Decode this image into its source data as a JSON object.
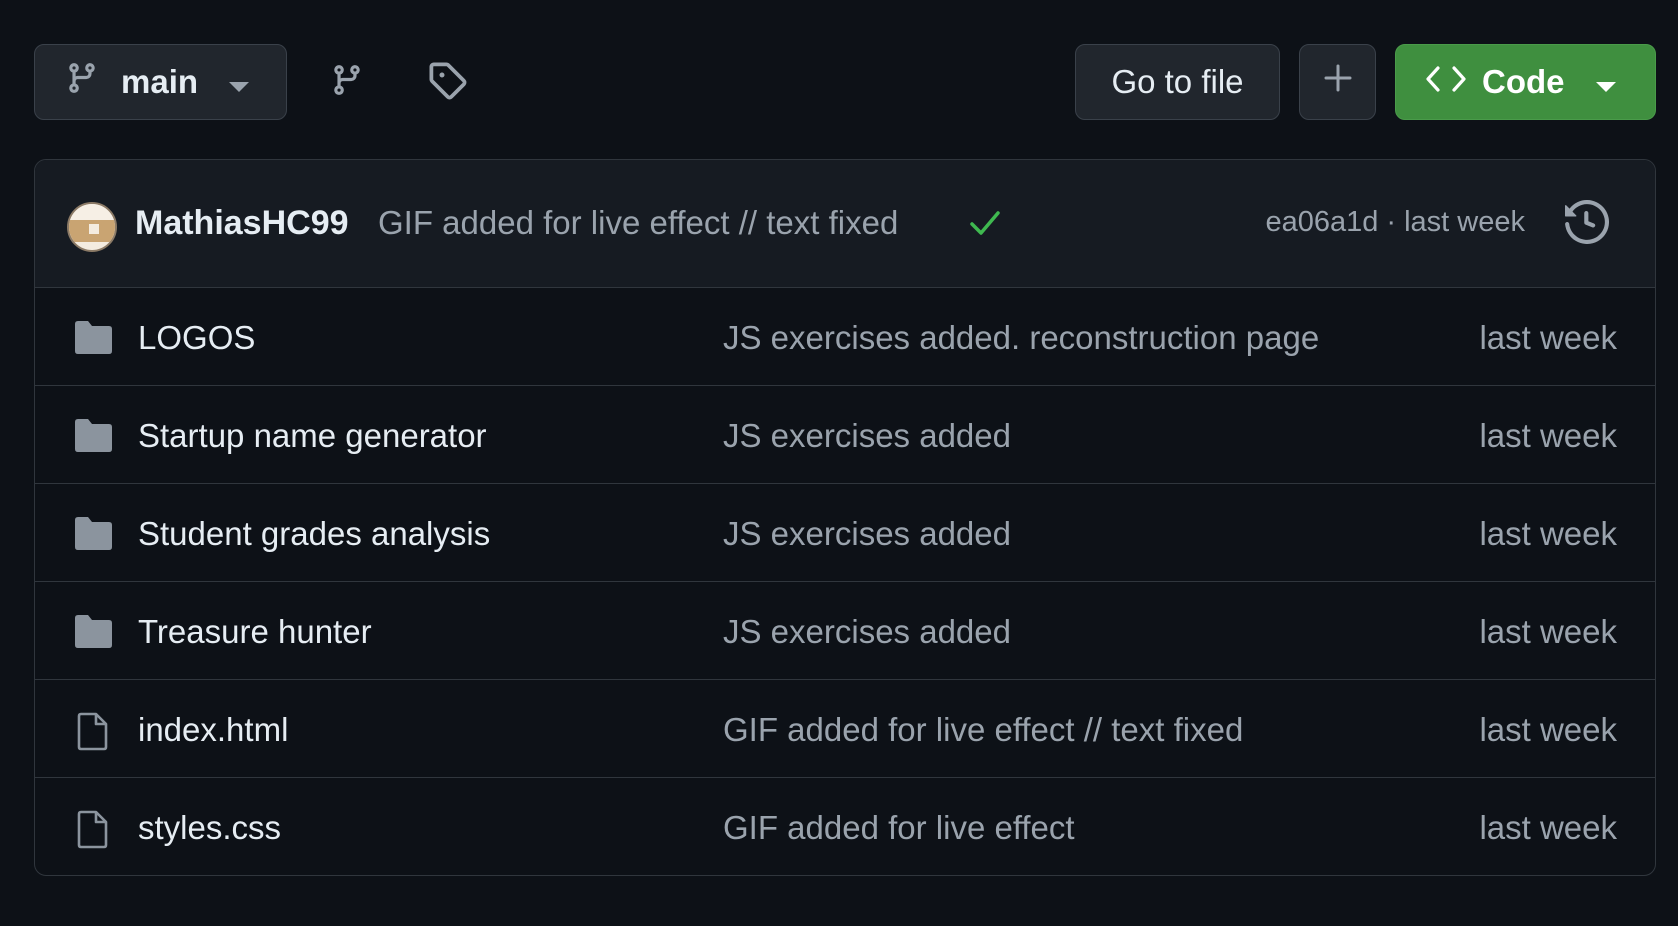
{
  "toolbar": {
    "branch_label": "main",
    "goto_label": "Go to file",
    "code_label": "Code"
  },
  "commit": {
    "author": "MathiasHC99",
    "message": "GIF added for live effect // text fixed",
    "sha_time": "ea06a1d · last week"
  },
  "files": [
    {
      "type": "folder",
      "name": "LOGOS",
      "message": "JS exercises added. reconstruction page",
      "date": "last week"
    },
    {
      "type": "folder",
      "name": "Startup name generator",
      "message": "JS exercises added",
      "date": "last week"
    },
    {
      "type": "folder",
      "name": "Student grades analysis",
      "message": "JS exercises added",
      "date": "last week"
    },
    {
      "type": "folder",
      "name": "Treasure hunter",
      "message": "JS exercises added",
      "date": "last week"
    },
    {
      "type": "file",
      "name": "index.html",
      "message": "GIF added for live effect // text fixed",
      "date": "last week"
    },
    {
      "type": "file",
      "name": "styles.css",
      "message": "GIF added for live effect",
      "date": "last week"
    }
  ],
  "colors": {
    "background": "#0d1117",
    "code_button": "#3f8f3f",
    "check": "#3fb950"
  }
}
